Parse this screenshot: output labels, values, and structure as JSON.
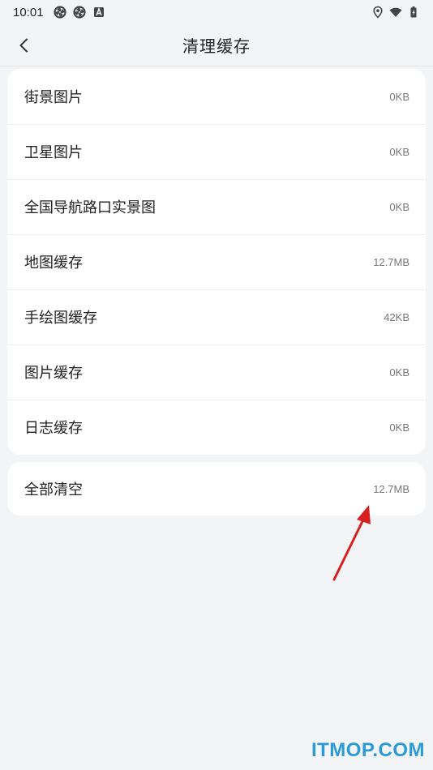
{
  "status_bar": {
    "time": "10:01",
    "left_icons": [
      "aperture-icon",
      "aperture-icon",
      "a-badge-icon"
    ],
    "right_icons": [
      "location-pin-icon",
      "wifi-icon",
      "battery-icon"
    ]
  },
  "header": {
    "back_icon": "chevron-left-icon",
    "title": "清理缓存"
  },
  "cache_items": [
    {
      "label": "街景图片",
      "size": "0KB"
    },
    {
      "label": "卫星图片",
      "size": "0KB"
    },
    {
      "label": "全国导航路口实景图",
      "size": "0KB"
    },
    {
      "label": "地图缓存",
      "size": "12.7MB"
    },
    {
      "label": "手绘图缓存",
      "size": "42KB"
    },
    {
      "label": "图片缓存",
      "size": "0KB"
    },
    {
      "label": "日志缓存",
      "size": "0KB"
    }
  ],
  "clear_all": {
    "label": "全部清空",
    "size": "12.7MB"
  },
  "watermark": "ITMOP.COM",
  "colors": {
    "background": "#f3f4f6",
    "card": "#ffffff",
    "annotation_arrow": "#d61f1f",
    "watermark": "#2a9bd8"
  }
}
